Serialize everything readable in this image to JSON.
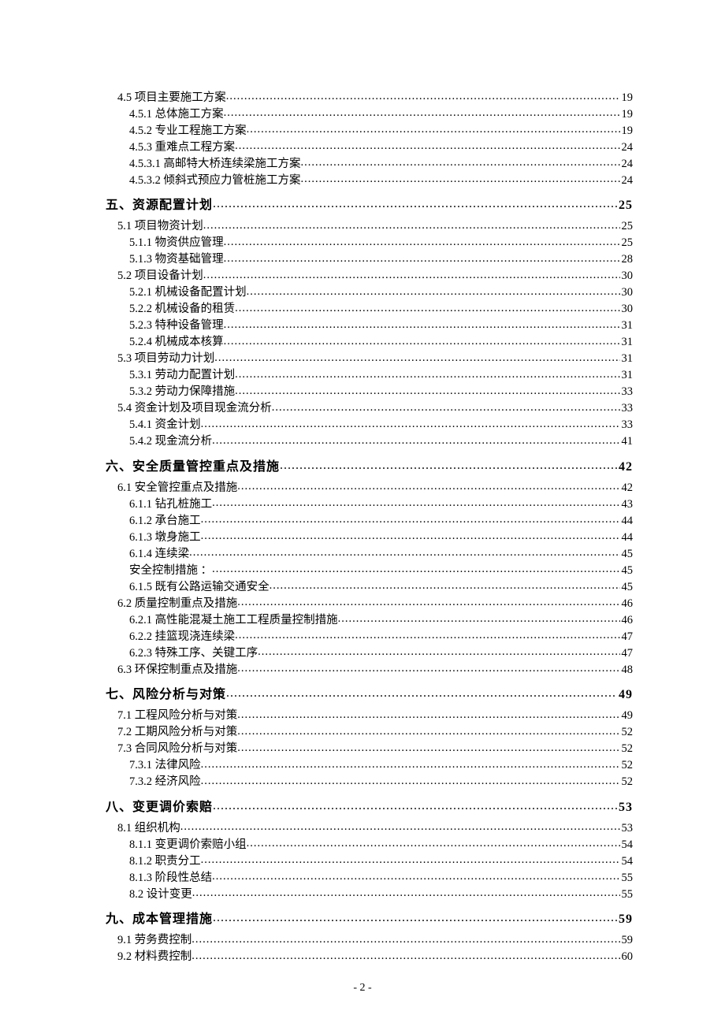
{
  "toc": [
    {
      "level": 2,
      "text": "4.5 项目主要施工方案",
      "page": "19"
    },
    {
      "level": 3,
      "text": "4.5.1 总体施工方案",
      "page": "19"
    },
    {
      "level": 3,
      "text": "4.5.2 专业工程施工方案",
      "page": "19"
    },
    {
      "level": 3,
      "text": "4.5.3 重难点工程方案",
      "page": "24"
    },
    {
      "level": 4,
      "text": "4.5.3.1 高邮特大桥连续梁施工方案",
      "page": "24"
    },
    {
      "level": 4,
      "text": "4.5.3.2 倾斜式预应力管桩施工方案",
      "page": "24"
    },
    {
      "level": 1,
      "text": "五、资源配置计划",
      "page": "25"
    },
    {
      "level": 2,
      "text": "5.1 项目物资计划",
      "page": "25"
    },
    {
      "level": 3,
      "text": "5.1.1 物资供应管理",
      "page": "25"
    },
    {
      "level": 3,
      "text": "5.1.3 物资基础管理",
      "page": "28"
    },
    {
      "level": 2,
      "text": "5.2 项目设备计划",
      "page": "30"
    },
    {
      "level": 3,
      "text": "5.2.1 机械设备配置计划",
      "page": "30"
    },
    {
      "level": 3,
      "text": "5.2.2 机械设备的租赁",
      "page": "30"
    },
    {
      "level": 3,
      "text": "5.2.3 特种设备管理",
      "page": "31"
    },
    {
      "level": 3,
      "text": "5.2.4 机械成本核算",
      "page": "31"
    },
    {
      "level": 2,
      "text": "5.3 项目劳动力计划",
      "page": "31"
    },
    {
      "level": 3,
      "text": "5.3.1 劳动力配置计划",
      "page": "31"
    },
    {
      "level": 3,
      "text": "5.3.2 劳动力保障措施",
      "page": "33"
    },
    {
      "level": 2,
      "text": "5.4 资金计划及项目现金流分析",
      "page": "33"
    },
    {
      "level": 3,
      "text": "5.4.1 资金计划",
      "page": "33"
    },
    {
      "level": 3,
      "text": "5.4.2 现金流分析",
      "page": "41"
    },
    {
      "level": 1,
      "text": "六、安全质量管控重点及措施",
      "page": "42"
    },
    {
      "level": 2,
      "text": "6.1 安全管控重点及措施",
      "page": "42"
    },
    {
      "level": 3,
      "text": "6.1.1 钻孔桩施工",
      "page": "43"
    },
    {
      "level": 3,
      "text": "6.1.2 承台施工",
      "page": "44"
    },
    {
      "level": 3,
      "text": "6.1.3 墩身施工",
      "page": "44"
    },
    {
      "level": 3,
      "text": "6.1.4 连续梁",
      "page": "45"
    },
    {
      "level": 3,
      "text": "安全控制措施 ：",
      "page": "45"
    },
    {
      "level": 3,
      "text": "6.1.5 既有公路运输交通安全",
      "page": "45"
    },
    {
      "level": 2,
      "text": "6.2 质量控制重点及措施",
      "page": "46"
    },
    {
      "level": 3,
      "text": "6.2.1 高性能混凝土施工工程质量控制措施",
      "page": "46"
    },
    {
      "level": 3,
      "text": "6.2.2 挂篮现浇连续梁",
      "page": "47"
    },
    {
      "level": 3,
      "text": "6.2.3  特殊工序、关键工序 ",
      "page": "47"
    },
    {
      "level": 2,
      "text": "6.3 环保控制重点及措施",
      "page": "48"
    },
    {
      "level": 1,
      "text": "七、风险分析与对策",
      "page": "49"
    },
    {
      "level": 2,
      "text": "7.1 工程风险分析与对策",
      "page": "49"
    },
    {
      "level": 2,
      "text": "7.2 工期风险分析与对策",
      "page": "52"
    },
    {
      "level": 2,
      "text": "7.3 合同风险分析与对策",
      "page": "52"
    },
    {
      "level": 3,
      "text": "7.3.1 法律风险",
      "page": "52"
    },
    {
      "level": 3,
      "text": "7.3.2 经济风险",
      "page": "52"
    },
    {
      "level": 1,
      "text": "八、变更调价索赔",
      "page": "53"
    },
    {
      "level": 2,
      "text": "8.1 组织机构",
      "page": "53"
    },
    {
      "level": 3,
      "text": "8.1.1 变更调价索赔小组",
      "page": "54"
    },
    {
      "level": 3,
      "text": "8.1.2 职责分工",
      "page": "54"
    },
    {
      "level": 3,
      "text": "8.1.3 阶段性总结",
      "page": "55"
    },
    {
      "level": 3,
      "text": "8.2 设计变更",
      "page": "55"
    },
    {
      "level": 1,
      "text": "九、成本管理措施",
      "page": "59"
    },
    {
      "level": 2,
      "text": "9.1 劳务费控制",
      "page": "59"
    },
    {
      "level": 2,
      "text": "9.2 材料费控制",
      "page": "60"
    }
  ],
  "page_number": "- 2 -"
}
